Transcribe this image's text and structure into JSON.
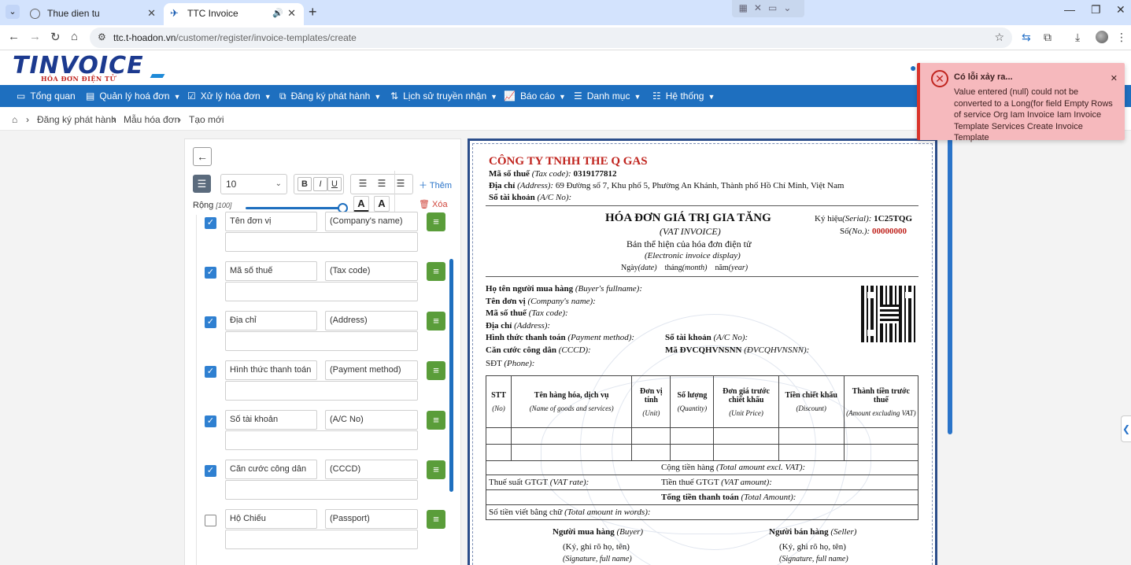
{
  "browser": {
    "tabs": [
      {
        "title": "Thue dien tu",
        "active": false
      },
      {
        "title": "TTC Invoice",
        "active": true
      }
    ],
    "url_host": "ttc.t-hoadon.vn",
    "url_path": "/customer/register/invoice-templates/create"
  },
  "app": {
    "logo_text": "TINVOICE",
    "logo_sub": "HÓA ĐƠN ĐIỆN TỬ",
    "menu": [
      {
        "label": "Tổng quan",
        "icon": "monitor-icon",
        "caret": false
      },
      {
        "label": "Quản lý hoá đơn",
        "icon": "file-icon",
        "caret": true
      },
      {
        "label": "Xử lý hóa đơn",
        "icon": "check-square-icon",
        "caret": true
      },
      {
        "label": "Đăng ký phát hành",
        "icon": "external-link-icon",
        "caret": true
      },
      {
        "label": "Lịch sử truyền nhận",
        "icon": "swap-icon",
        "caret": true
      },
      {
        "label": "Báo cáo",
        "icon": "chart-icon",
        "caret": true
      },
      {
        "label": "Danh mục",
        "icon": "list-icon",
        "caret": true
      },
      {
        "label": "Hệ thống",
        "icon": "sliders-icon",
        "caret": true
      }
    ],
    "breadcrumb": [
      "Đăng ký phát hành",
      "Mẫu hóa đơn",
      "Tạo mới"
    ]
  },
  "editor": {
    "font_size": "10",
    "add_label": "Thêm",
    "delete_label": "Xóa",
    "width_label": "Rộng",
    "width_value": "[100]",
    "fields": [
      {
        "vi": "Tên đơn vị",
        "en": "(Company's name)",
        "checked": true
      },
      {
        "vi": "Mã số thuế",
        "en": "(Tax code)",
        "checked": true
      },
      {
        "vi": "Địa chỉ",
        "en": "(Address)",
        "checked": true
      },
      {
        "vi": "Hình thức thanh toán",
        "en": "(Payment method)",
        "checked": true
      },
      {
        "vi": "Số tài khoản",
        "en": "(A/C No)",
        "checked": true
      },
      {
        "vi": "Căn cước công dân",
        "en": "(CCCD)",
        "checked": true
      },
      {
        "vi": "Hộ Chiếu",
        "en": "(Passport)",
        "checked": false
      }
    ]
  },
  "invoice": {
    "company": "CÔNG TY TNHH THE Q GAS",
    "tax_code_label": "Mã số thuế",
    "tax_code_en": "(Tax code):",
    "tax_code": "0319177812",
    "address_label": "Địa chỉ",
    "address_en": "(Address):",
    "address": "69 Đường số 7, Khu phố 5, Phường An Khánh, Thành phố Hồ Chí Minh, Việt Nam",
    "account_label": "Số tài khoản",
    "account_en": "(A/C No):",
    "title": "HÓA ĐƠN GIÁ TRỊ GIA TĂNG",
    "title_en": "(VAT INVOICE)",
    "display_vi": "Bản thể hiện của hóa đơn điện tử",
    "display_en": "(Electronic invoice display)",
    "date_line": [
      "Ngày",
      "(date)",
      "tháng",
      "(month)",
      "năm",
      "(year)"
    ],
    "serial_label": "Ký hiệu",
    "serial_en": "(Serial):",
    "serial": "1C25TQG",
    "no_label": "Số",
    "no_en": "(No.):",
    "no": "00000000",
    "buyer_lines": [
      {
        "vi": "Họ tên người mua hàng",
        "en": "(Buyer's fullname):"
      },
      {
        "vi": "Tên đơn vị",
        "en": "(Company's name):"
      },
      {
        "vi": "Mã số thuế",
        "en": "(Tax code):"
      },
      {
        "vi": "Địa chỉ",
        "en": "(Address):"
      },
      {
        "vi": "Hình thức thanh toán",
        "en": "(Payment method):"
      },
      {
        "vi": "Căn cước công dân",
        "en": "(CCCD):"
      }
    ],
    "buyer_right": [
      {
        "vi": "Số tài khoản",
        "en": "(A/C No):"
      },
      {
        "vi": "Mã ĐVCQHVNSNN",
        "en": "(ĐVCQHVNSNN):"
      }
    ],
    "phone_vi": "SĐT",
    "phone_en": "(Phone):",
    "columns": [
      {
        "vi": "STT",
        "en": "(No)"
      },
      {
        "vi": "Tên hàng hóa, dịch vụ",
        "en": "(Name of goods and services)"
      },
      {
        "vi": "Đơn vị tính",
        "en": "(Unit)"
      },
      {
        "vi": "Số lượng",
        "en": "(Quantity)"
      },
      {
        "vi": "Đơn giá trước chiết khấu",
        "en": "(Unit Price)"
      },
      {
        "vi": "Tiền chiết khấu",
        "en": "(Discount)"
      },
      {
        "vi": "Thành tiền trước thuế",
        "en": "(Amount excluding VAT)"
      }
    ],
    "total_excl_vi": "Cộng tiền hàng",
    "total_excl_en": "(Total amount excl. VAT):",
    "vat_rate_vi": "Thuế suất GTGT",
    "vat_rate_en": "(VAT rate):",
    "vat_amount_vi": "Tiền thuế GTGT",
    "vat_amount_en": "(VAT amount):",
    "total_vi": "Tổng tiền thanh toán",
    "total_en": "(Total Amount):",
    "words_vi": "Số tiền viết bằng chữ",
    "words_en": "(Total amount in words):",
    "buyer_sig_vi": "Người mua hàng",
    "buyer_sig_en": "(Buyer)",
    "seller_sig_vi": "Người bán hàng",
    "seller_sig_en": "(Seller)",
    "sign_vi": "(Ký, ghi rõ họ, tên)",
    "sign_en": "(Signature, full name)"
  },
  "toast": {
    "title": "Có lỗi xảy ra...",
    "message": "Value entered (null) could not be converted to a Long(for field Empty Rows of service Org Iam Invoice Iam Invoice Template Services Create Invoice Template"
  }
}
